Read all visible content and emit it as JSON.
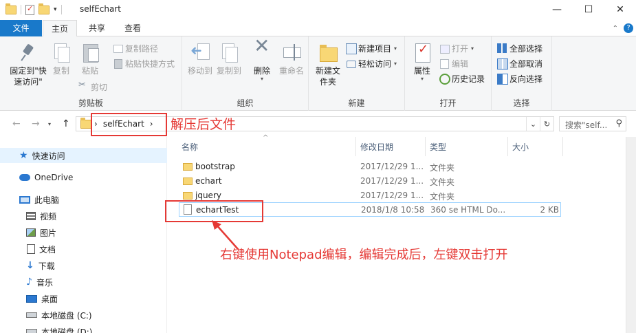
{
  "window": {
    "title": "selfEchart",
    "minimize_glyph": "—",
    "maximize_glyph": "☐",
    "close_glyph": "✕",
    "qat_dropdown_glyph": "▾"
  },
  "tabs": {
    "file": "文件",
    "home": "主页",
    "share": "共享",
    "view": "查看",
    "collapse_glyph": "⌃",
    "help_glyph": "?"
  },
  "ribbon": {
    "clipboard": {
      "label": "剪贴板",
      "pin": "固定到\"快速访问\"",
      "copy": "复制",
      "paste": "粘贴",
      "copy_path": "复制路径",
      "paste_shortcut": "粘贴快捷方式",
      "cut": "剪切"
    },
    "organize": {
      "label": "组织",
      "move_to": "移动到",
      "copy_to": "复制到",
      "delete": "删除",
      "rename": "重命名"
    },
    "new": {
      "label": "新建",
      "new_folder": "新建文件夹",
      "new_item": "新建项目",
      "easy_access": "轻松访问"
    },
    "open": {
      "label": "打开",
      "properties": "属性",
      "open": "打开",
      "edit": "编辑",
      "history": "历史记录"
    },
    "select": {
      "label": "选择",
      "select_all": "全部选择",
      "select_none": "全部取消",
      "invert": "反向选择"
    },
    "dropdown_glyph": "▾"
  },
  "address": {
    "crumb_sep": "›",
    "crumb": "selfEchart",
    "back_glyph": "←",
    "forward_glyph": "→",
    "up_glyph": "↑",
    "dropdown_glyph": "⌄",
    "refresh_glyph": "↻",
    "search_placeholder": "搜索\"self...",
    "search_glyph": "⚲"
  },
  "nav": {
    "items": [
      {
        "label": "快速访问",
        "icon": "star-icon"
      },
      {
        "label": "OneDrive",
        "icon": "cloud-icon"
      },
      {
        "label": "此电脑",
        "icon": "computer-icon"
      },
      {
        "label": "视频",
        "icon": "video-icon"
      },
      {
        "label": "图片",
        "icon": "picture-icon"
      },
      {
        "label": "文档",
        "icon": "document-icon"
      },
      {
        "label": "下载",
        "icon": "download-icon"
      },
      {
        "label": "音乐",
        "icon": "music-icon"
      },
      {
        "label": "桌面",
        "icon": "desktop-icon"
      },
      {
        "label": "本地磁盘 (C:)",
        "icon": "disk-icon"
      },
      {
        "label": "本地磁盘 (D:)",
        "icon": "disk-icon"
      }
    ],
    "star_glyph": "★",
    "down_glyph": "↓",
    "music_glyph": "♪"
  },
  "files": {
    "columns": {
      "name": "名称",
      "date": "修改日期",
      "type": "类型",
      "size": "大小"
    },
    "sort_glyph": "^",
    "rows": [
      {
        "name": "bootstrap",
        "date": "2017/12/29 1...",
        "type": "文件夹",
        "size": ""
      },
      {
        "name": "echart",
        "date": "2017/12/29 1...",
        "type": "文件夹",
        "size": ""
      },
      {
        "name": "jquery",
        "date": "2017/12/29 1...",
        "type": "文件夹",
        "size": ""
      },
      {
        "name": "echartTest",
        "date": "2018/1/8 10:58",
        "type": "360 se HTML Do...",
        "size": "2 KB"
      }
    ]
  },
  "annotations": {
    "unzipped": "解压后文件",
    "instruction": "右键使用Notepad编辑，编辑完成后，左键双击打开",
    "color": "#e53935"
  }
}
